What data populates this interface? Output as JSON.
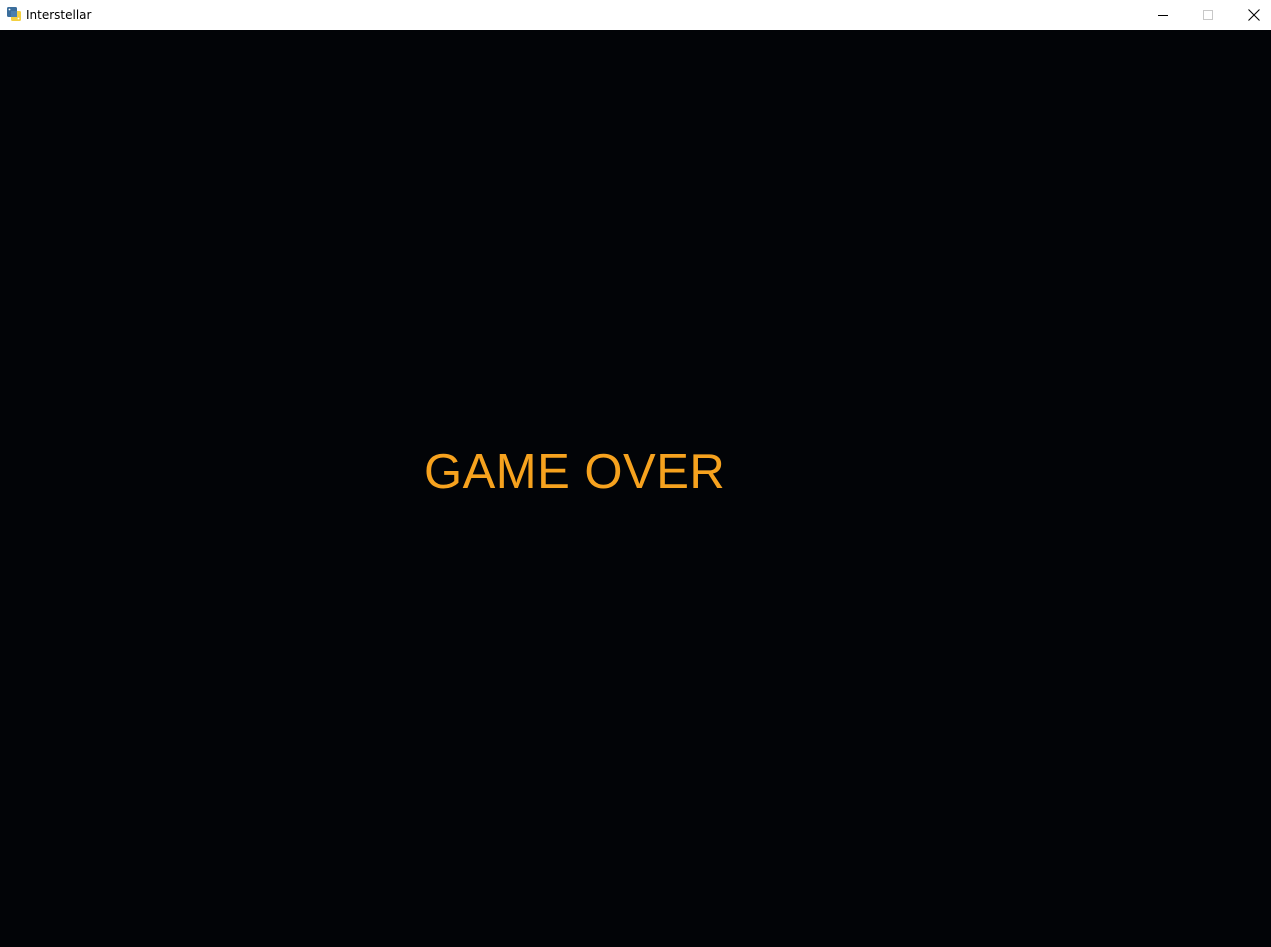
{
  "window": {
    "title": "Interstellar",
    "app_icon": "python-icon",
    "controls": {
      "minimize_icon": "minimize-icon",
      "maximize_icon": "maximize-icon",
      "close_icon": "close-icon"
    }
  },
  "game": {
    "message": "GAME OVER",
    "message_color": "#F6A21E",
    "background_color": "#020407"
  }
}
